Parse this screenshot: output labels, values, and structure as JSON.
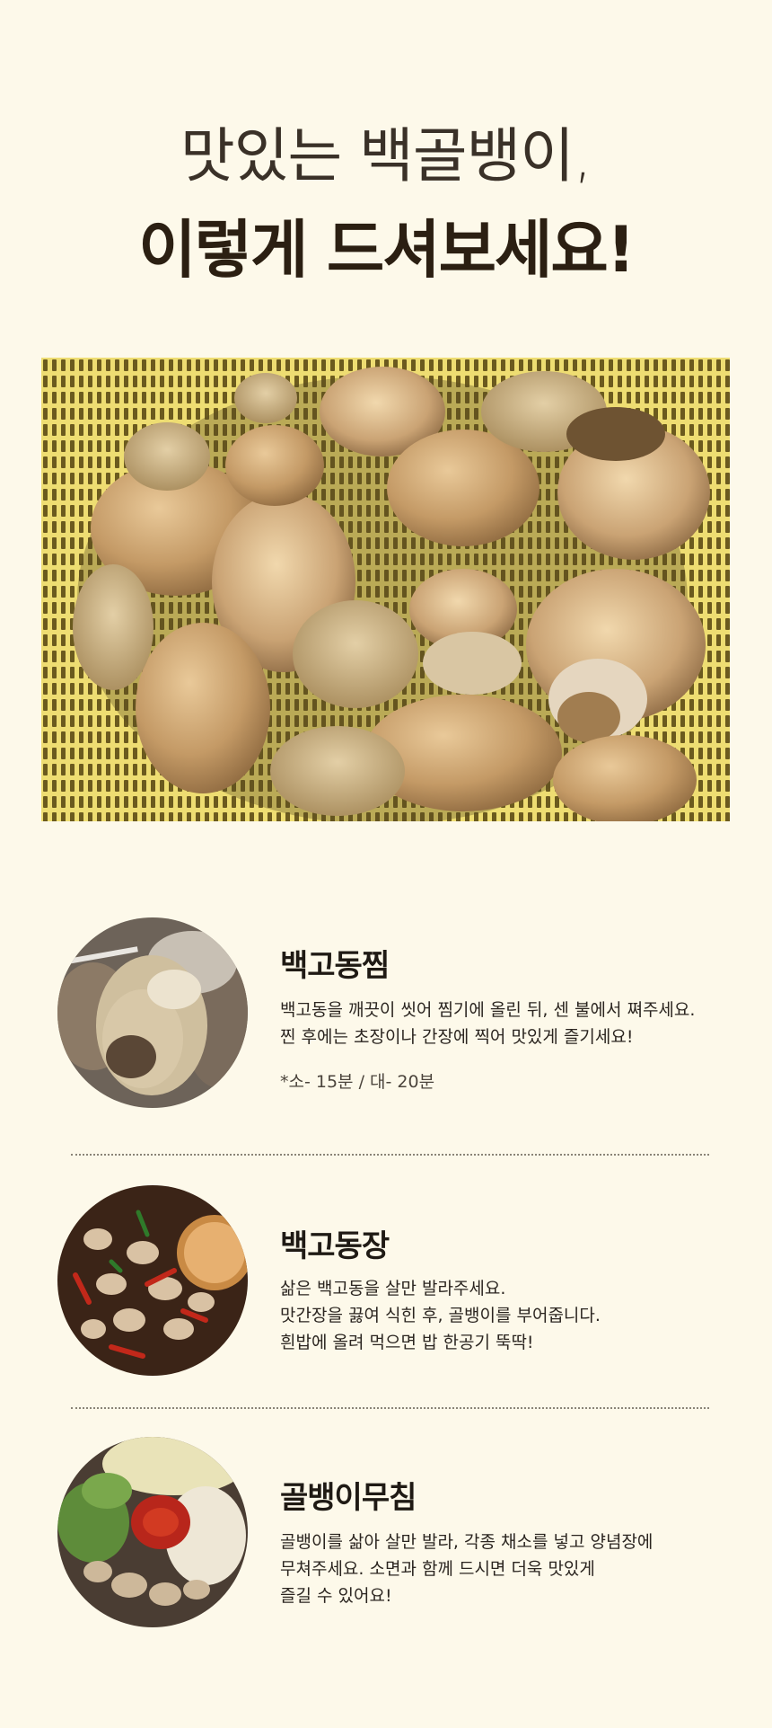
{
  "heading": {
    "line1": "맛있는 백골뱅이,",
    "line2": "이렇게 드셔보세요!"
  },
  "recipes": [
    {
      "title": "백고동찜",
      "lines": [
        "백고동을 깨끗이 씻어 찜기에 올린 뒤, 센 불에서 쪄주세요.",
        "찐 후에는 초장이나 간장에 찍어 맛있게 즐기세요!"
      ],
      "note": "*소- 15분 /  대- 20분"
    },
    {
      "title": "백고동장",
      "lines": [
        "삶은 백고동을 살만 발라주세요.",
        "맛간장을 끓여 식힌 후, 골뱅이를 부어줍니다.",
        "흰밥에 올려 먹으면 밥 한공기 뚝딱!"
      ]
    },
    {
      "title": "골뱅이무침",
      "lines": [
        "골뱅이를 삶아 살만 발라, 각종 채소를 넣고 양념장에",
        "무쳐주세요. 소면과 함께 드시면 더욱 맛있게",
        "즐길 수 있어요!"
      ]
    }
  ]
}
